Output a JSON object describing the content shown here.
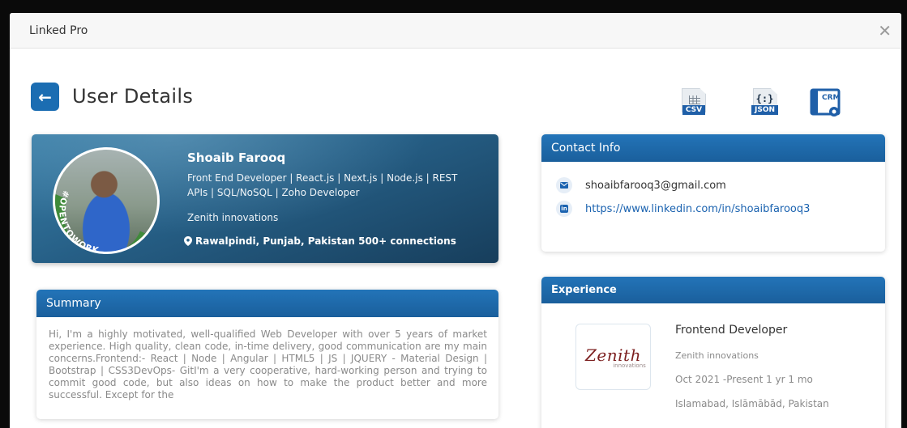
{
  "window": {
    "title": "Linked Pro",
    "close_glyph": "✕"
  },
  "page": {
    "title": "User Details",
    "back_glyph": "←"
  },
  "exports": [
    {
      "label": "CSV",
      "icon": "csv-file-icon"
    },
    {
      "label": "JSON",
      "icon": "json-file-icon",
      "glyph": "{:}"
    },
    {
      "label": "CRM",
      "icon": "crm-icon"
    }
  ],
  "profile": {
    "name": "Shoaib Farooq",
    "headline": "Front End Developer | React.js | Next.js | Node.js | REST APIs | SQL/NoSQL | Zoho Developer",
    "company": "Zenith innovations",
    "location": "Rawalpindi, Punjab, Pakistan 500+ connections",
    "badge": "#OPENTOWORK"
  },
  "summary": {
    "heading": "Summary",
    "text": "Hi, I'm a highly motivated, well-qualified Web Developer with over 5 years of market experience. High quality, clean code, in-time delivery, good communication are my main concerns.Frontend:- React | Node | Angular | HTML5 | JS | JQUERY - Material Design | Bootstrap | CSS3DevOps- GitI'm a very cooperative, hard-working person and trying to commit good code, but also ideas on how to make the product better and more successful. Except for the"
  },
  "contact": {
    "heading": "Contact Info",
    "email": "shoaibfarooq3@gmail.com",
    "linkedin": "https://www.linkedin.com/in/shoaibfarooq3",
    "linkedin_glyph": "in"
  },
  "experience": {
    "heading": "Experience",
    "items": [
      {
        "logo_text": "Zenith",
        "logo_sub": "innovations",
        "title": "Frontend Developer",
        "company": "Zenith innovations",
        "dates": "Oct 2021 -Present 1 yr 1 mo",
        "location": "Islamabad, Islāmābād, Pakistan"
      }
    ]
  },
  "colors": {
    "primary": "#1b6db2",
    "header": "#2374b8",
    "link": "#1b63b0"
  }
}
